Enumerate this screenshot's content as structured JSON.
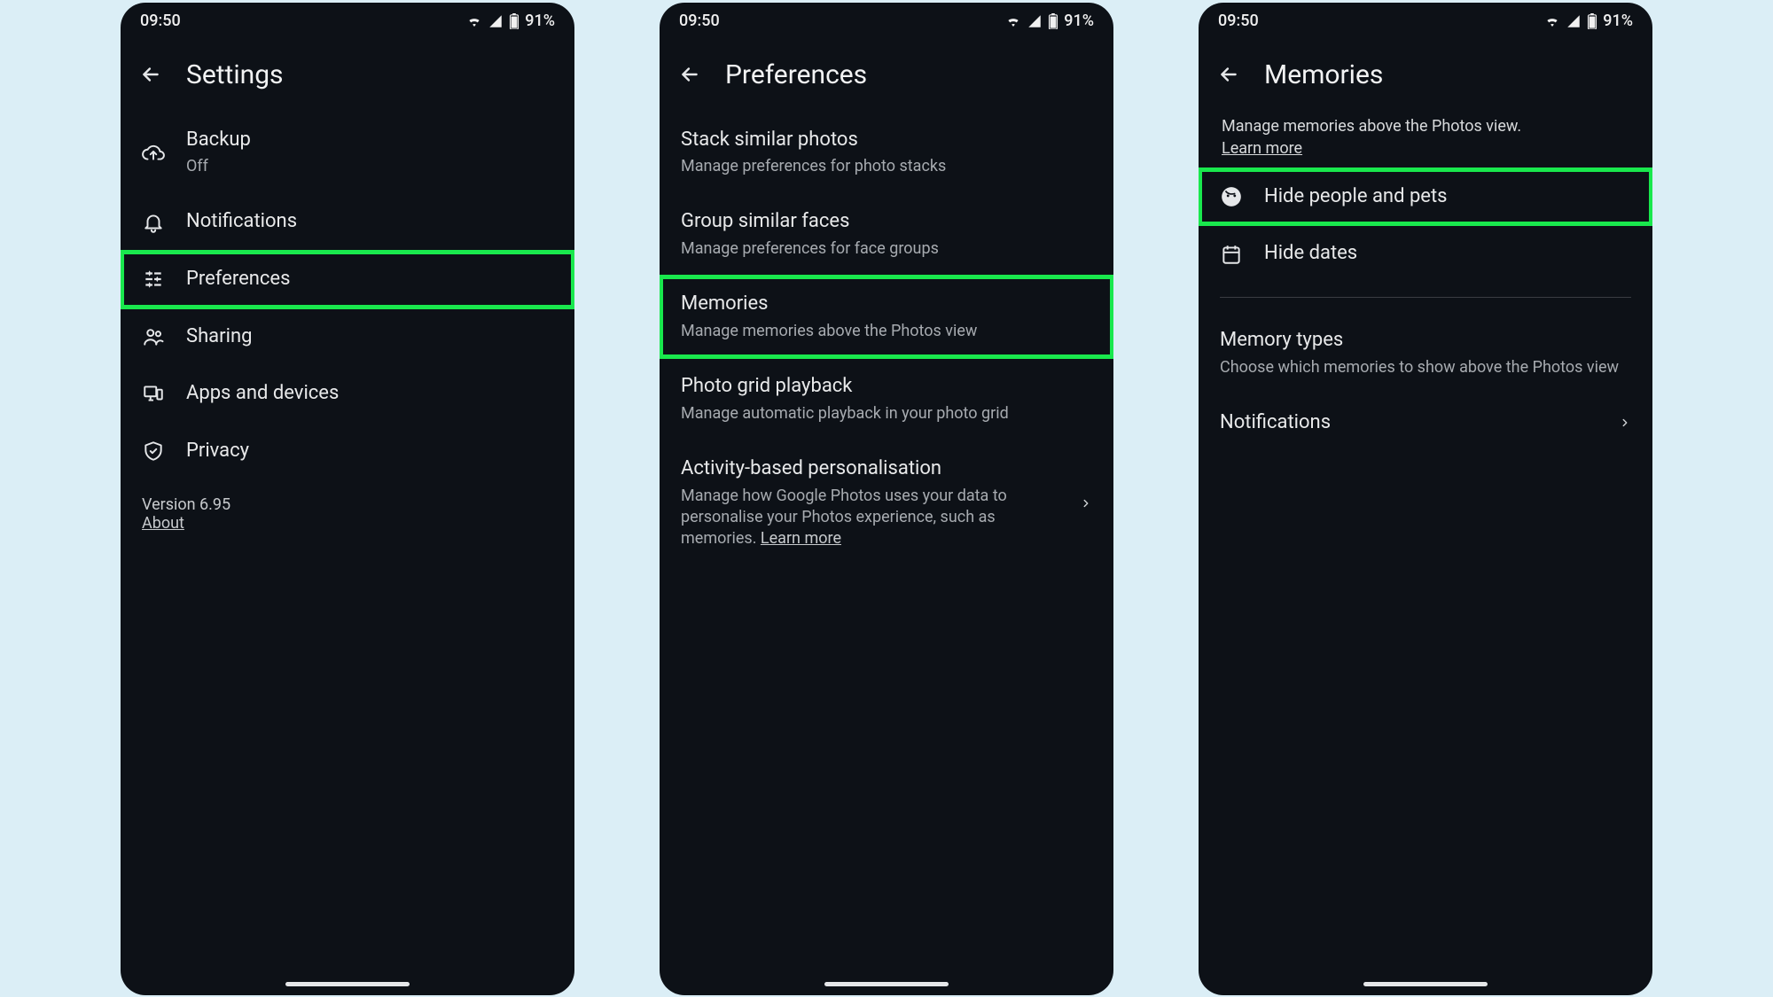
{
  "status": {
    "time": "09:50",
    "battery": "91%"
  },
  "screens": [
    {
      "title": "Settings",
      "backType": "arrow",
      "footer": {
        "version": "Version 6.95",
        "about": "About"
      },
      "items": [
        {
          "icon": "cloud-upload",
          "title": "Backup",
          "sub": "Off"
        },
        {
          "icon": "bell",
          "title": "Notifications"
        },
        {
          "icon": "tune",
          "title": "Preferences",
          "highlight": true
        },
        {
          "icon": "people",
          "title": "Sharing"
        },
        {
          "icon": "devices",
          "title": "Apps and devices"
        },
        {
          "icon": "shield",
          "title": "Privacy"
        }
      ]
    },
    {
      "title": "Preferences",
      "backType": "arrow",
      "items": [
        {
          "title": "Stack similar photos",
          "sub": "Manage preferences for photo stacks"
        },
        {
          "title": "Group similar faces",
          "sub": "Manage preferences for face groups"
        },
        {
          "title": "Memories",
          "sub": "Manage memories above the Photos view",
          "highlight": true
        },
        {
          "title": "Photo grid playback",
          "sub": "Manage automatic playback in your photo grid"
        },
        {
          "title": "Activity-based personalisation",
          "sub": "Manage how Google Photos uses your data to personalise your Photos experience, such as memories.",
          "linkText": "Learn more",
          "chevron": true
        }
      ]
    },
    {
      "title": "Memories",
      "backType": "arrow",
      "intro": {
        "text": "Manage memories above the Photos view.",
        "linkText": "Learn more"
      },
      "items": [
        {
          "icon": "face",
          "title": "Hide people and pets",
          "highlight": true
        },
        {
          "icon": "calendar",
          "title": "Hide dates"
        },
        {
          "divider": true
        },
        {
          "title": "Memory types",
          "sub": "Choose which memories to show above the Photos view"
        },
        {
          "title": "Notifications",
          "chevron": true
        }
      ]
    }
  ]
}
